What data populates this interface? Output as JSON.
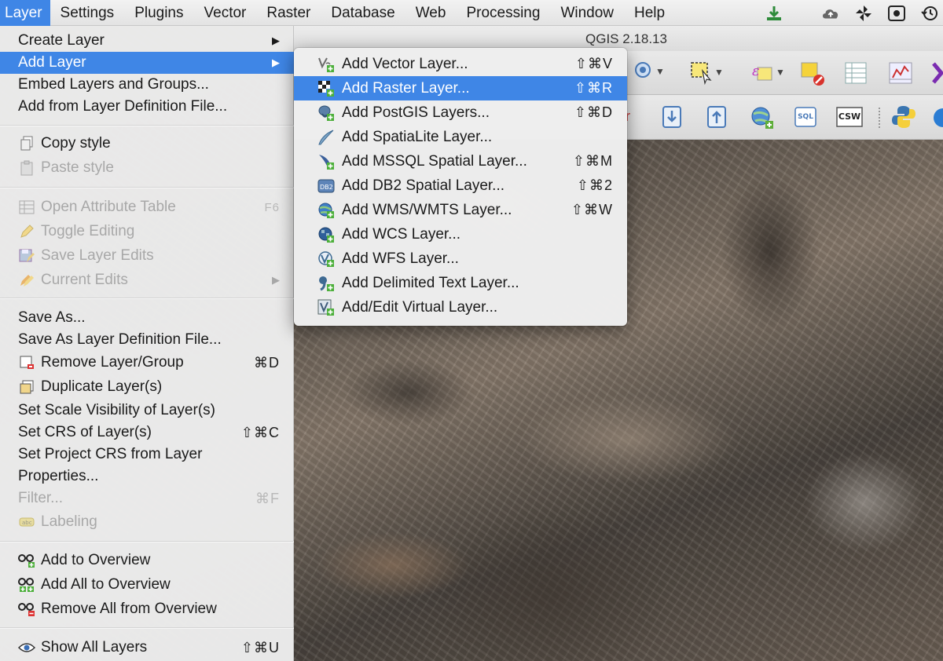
{
  "menubar": {
    "items": [
      "Layer",
      "Settings",
      "Plugins",
      "Vector",
      "Raster",
      "Database",
      "Web",
      "Processing",
      "Window",
      "Help"
    ],
    "active": "Layer"
  },
  "window": {
    "title": "QGIS 2.18.13"
  },
  "layer_menu": {
    "items": [
      {
        "label": "Create Layer",
        "arrow": "▶",
        "enabled": true
      },
      {
        "label": "Add Layer",
        "arrow": "▶",
        "enabled": true,
        "highlighted": true
      },
      {
        "label": "Embed Layers and Groups...",
        "enabled": true
      },
      {
        "label": "Add from Layer Definition File...",
        "enabled": true
      },
      {
        "label": "Copy style",
        "icon": "copy-icon",
        "enabled": true
      },
      {
        "label": "Paste style",
        "icon": "paste-icon",
        "enabled": false
      },
      {
        "label": "Open Attribute Table",
        "icon": "table-icon",
        "shortcut": "F6",
        "enabled": false
      },
      {
        "label": "Toggle Editing",
        "icon": "pencil-icon",
        "enabled": false
      },
      {
        "label": "Save Layer Edits",
        "icon": "save-edits-icon",
        "enabled": false
      },
      {
        "label": "Current Edits",
        "icon": "pencils-icon",
        "arrow": "▶",
        "enabled": false
      },
      {
        "label": "Save As...",
        "enabled": true
      },
      {
        "label": "Save As Layer Definition File...",
        "enabled": true
      },
      {
        "label": "Remove Layer/Group",
        "icon": "remove-layer-icon",
        "shortcut": "⌘D",
        "enabled": true
      },
      {
        "label": "Duplicate Layer(s)",
        "icon": "duplicate-layer-icon",
        "enabled": true
      },
      {
        "label": "Set Scale Visibility of Layer(s)",
        "enabled": true
      },
      {
        "label": "Set CRS of Layer(s)",
        "shortcut": "⇧⌘C",
        "enabled": true
      },
      {
        "label": "Set Project CRS from Layer",
        "enabled": true
      },
      {
        "label": "Properties...",
        "enabled": true
      },
      {
        "label": "Filter...",
        "shortcut": "⌘F",
        "enabled": false
      },
      {
        "label": "Labeling",
        "icon": "labeling-icon",
        "enabled": false
      },
      {
        "label": "Add to Overview",
        "icon": "overview-add-icon",
        "enabled": true
      },
      {
        "label": "Add All to Overview",
        "icon": "overview-add-all-icon",
        "enabled": true
      },
      {
        "label": "Remove All from Overview",
        "icon": "overview-remove-icon",
        "enabled": true
      },
      {
        "label": "Show All Layers",
        "icon": "eye-icon",
        "shortcut": "⇧⌘U",
        "enabled": true
      }
    ]
  },
  "add_layer_submenu": {
    "items": [
      {
        "label": "Add Vector Layer...",
        "icon": "vector-layer-icon",
        "shortcut": "⇧⌘V"
      },
      {
        "label": "Add Raster Layer...",
        "icon": "raster-layer-icon",
        "shortcut": "⇧⌘R",
        "highlighted": true
      },
      {
        "label": "Add PostGIS Layers...",
        "icon": "postgis-icon",
        "shortcut": "⇧⌘D"
      },
      {
        "label": "Add SpatiaLite Layer...",
        "icon": "spatialite-icon",
        "shortcut": ""
      },
      {
        "label": "Add MSSQL Spatial Layer...",
        "icon": "mssql-icon",
        "shortcut": "⇧⌘M"
      },
      {
        "label": "Add DB2 Spatial Layer...",
        "icon": "db2-icon",
        "shortcut": "⇧⌘2"
      },
      {
        "label": "Add WMS/WMTS Layer...",
        "icon": "wms-globe-icon",
        "shortcut": "⇧⌘W"
      },
      {
        "label": "Add WCS Layer...",
        "icon": "wcs-globe-icon",
        "shortcut": ""
      },
      {
        "label": "Add WFS Layer...",
        "icon": "wfs-globe-icon",
        "shortcut": ""
      },
      {
        "label": "Add Delimited Text Layer...",
        "icon": "delimited-text-icon",
        "shortcut": ""
      },
      {
        "label": "Add/Edit Virtual Layer...",
        "icon": "virtual-layer-icon",
        "shortcut": ""
      }
    ]
  },
  "toolbar": {
    "sql_label": "SQL",
    "csw_label": "CSW"
  },
  "colors": {
    "highlight": "#3f86e6",
    "menu_bg": "#ececec",
    "disabled_text": "#a8a8a8"
  }
}
